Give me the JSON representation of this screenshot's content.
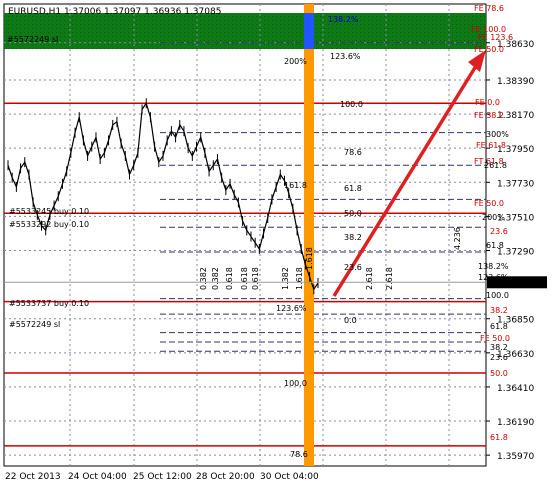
{
  "chart_data": {
    "type": "line",
    "title": "EURUSD,H1 1.37006 1.37097 1.36936 1.37085",
    "xlabel": "",
    "ylabel": "",
    "x_ticks": [
      "22 Oct 2013",
      "24 Oct 04:00",
      "25 Oct 12:00",
      "28 Oct 20:00",
      "30 Oct 04:00"
    ],
    "y_ticks": [
      "1.38630",
      "1.38390",
      "1.38170",
      "1.37950",
      "1.37730",
      "1.37510",
      "1.37290",
      "1.37085",
      "1.36850",
      "1.36630",
      "1.36410",
      "1.36190",
      "1.35970"
    ],
    "ylim": [
      1.359,
      1.3888
    ],
    "current_price": 1.37085,
    "current_price_label": "1.37085",
    "series": [
      {
        "values": [
          1.3784,
          1.3776,
          1.377,
          1.3782,
          1.3786,
          1.3778,
          1.376,
          1.3752,
          1.3745,
          1.3742,
          1.3752,
          1.3758,
          1.3764,
          1.3772,
          1.378,
          1.3792,
          1.3805,
          1.3815,
          1.38,
          1.379,
          1.3796,
          1.3802,
          1.3788,
          1.3792,
          1.38,
          1.381,
          1.3812,
          1.3798,
          1.379,
          1.3778,
          1.3784,
          1.3792,
          1.382,
          1.3824,
          1.3815,
          1.3796,
          1.3786,
          1.379,
          1.38,
          1.3806,
          1.3802,
          1.381,
          1.3806,
          1.3795,
          1.379,
          1.3796,
          1.3802,
          1.3792,
          1.378,
          1.3784,
          1.3788,
          1.3776,
          1.3768,
          1.3772,
          1.3765,
          1.376,
          1.3748,
          1.3742,
          1.3738,
          1.3734,
          1.373,
          1.374,
          1.375,
          1.3762,
          1.377,
          1.3778,
          1.3774,
          1.3766,
          1.3756,
          1.3742,
          1.373,
          1.372,
          1.3712,
          1.3704,
          1.3708
        ]
      }
    ],
    "orange_marker_label": "",
    "ask_label": "",
    "annotations": [
      {
        "text": "138.2%",
        "color": "#0000cc"
      },
      {
        "text": "123.6%",
        "color": "#000"
      },
      {
        "text": "200%",
        "color": "#000"
      },
      {
        "text": "100.0",
        "color": "#000"
      },
      {
        "text": "78.6",
        "color": "#000"
      },
      {
        "text": "61.8",
        "color": "#000"
      },
      {
        "text": "161.8",
        "color": "#000"
      },
      {
        "text": "50.0",
        "color": "#000"
      },
      {
        "text": "38.2",
        "color": "#000"
      },
      {
        "text": "23.6",
        "color": "#000"
      },
      {
        "text": "0.0",
        "color": "#000"
      },
      {
        "text": "123.6%",
        "color": "#000"
      },
      {
        "text": "100.0",
        "color": "#000"
      },
      {
        "text": "78.6",
        "color": "#000"
      }
    ],
    "vertical_labels": [
      "0.382",
      "0.382",
      "0.618",
      "0.618",
      "1.382",
      "1.618",
      "0.618",
      "1.618",
      "2.618",
      "2.618",
      "4.236"
    ],
    "order_labels": [
      "#5572249 sl",
      "#5533245 buy 0.10",
      "#5533292 buy 0.10",
      "#5533737 buy 0.10",
      "#5572249 sl"
    ],
    "fibo_right": [
      {
        "text": "FE 78.6",
        "color": "#cc0000"
      },
      {
        "text": "FE 100.0",
        "color": "#cc0000"
      },
      {
        "text": "FE 123.6",
        "color": "#cc0000"
      },
      {
        "text": "FE 50.0",
        "color": "#cc0000"
      },
      {
        "text": "FE 0.0",
        "color": "#cc0000"
      },
      {
        "text": "FE 38.2",
        "color": "#cc0000"
      },
      {
        "text": "FE 61.8",
        "color": "#cc0000"
      },
      {
        "text": "FT 61.8",
        "color": "#cc0000"
      },
      {
        "text": "300%",
        "color": "#000"
      },
      {
        "text": "261.8",
        "color": "#000"
      },
      {
        "text": "FE 50.0",
        "color": "#cc0000"
      },
      {
        "text": "200%",
        "color": "#000"
      },
      {
        "text": "23.6",
        "color": "#cc0000"
      },
      {
        "text": "61.8",
        "color": "#000"
      },
      {
        "text": "138.2%",
        "color": "#000"
      },
      {
        "text": "123.6%",
        "color": "#000"
      },
      {
        "text": "100.0",
        "color": "#000"
      },
      {
        "text": "38.2",
        "color": "#cc0000"
      },
      {
        "text": "61.8",
        "color": "#000"
      },
      {
        "text": "FE 50.0",
        "color": "#cc0000"
      },
      {
        "text": "38.2",
        "color": "#000"
      },
      {
        "text": "23.6",
        "color": "#000"
      },
      {
        "text": "50.0",
        "color": "#cc0000"
      },
      {
        "text": "61.8",
        "color": "#cc0000"
      }
    ],
    "grid": true,
    "colors": {
      "resistance": "#cc0000",
      "band": "#0e7a16",
      "marker": "#ff9900",
      "arrow": "#e02020"
    }
  }
}
